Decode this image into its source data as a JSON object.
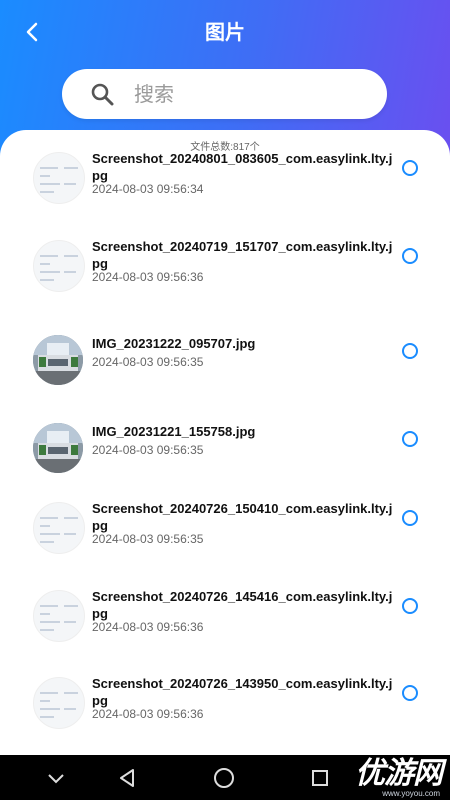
{
  "header": {
    "title": "图片",
    "back_icon": "chevron-left-icon",
    "gradient": [
      "#1a8cff",
      "#3f6df5",
      "#6a4ff0"
    ]
  },
  "search": {
    "placeholder": "搜索",
    "icon": "search-icon"
  },
  "summary": {
    "total_text": "文件总数:817个"
  },
  "files": [
    {
      "name": "Screenshot_20240801_083605_com.easylink.lty.jpg",
      "time": "2024-08-03 09:56:34",
      "thumb": "screenshot",
      "selected": false
    },
    {
      "name": "Screenshot_20240719_151707_com.easylink.lty.jpg",
      "time": "2024-08-03 09:56:36",
      "thumb": "screenshot",
      "selected": false
    },
    {
      "name": "IMG_20231222_095707.jpg",
      "time": "2024-08-03 09:56:35",
      "thumb": "photo",
      "selected": false
    },
    {
      "name": "IMG_20231221_155758.jpg",
      "time": "2024-08-03 09:56:35",
      "thumb": "photo",
      "selected": false
    },
    {
      "name": "Screenshot_20240726_150410_com.easylink.lty.jpg",
      "time": "2024-08-03 09:56:35",
      "thumb": "screenshot",
      "selected": false
    },
    {
      "name": "Screenshot_20240726_145416_com.easylink.lty.jpg",
      "time": "2024-08-03 09:56:36",
      "thumb": "screenshot",
      "selected": false
    },
    {
      "name": "Screenshot_20240726_143950_com.easylink.lty.jpg",
      "time": "2024-08-03 09:56:36",
      "thumb": "screenshot",
      "selected": false
    }
  ],
  "navbar": {
    "buttons": [
      "chevron-down-icon",
      "back-triangle-icon",
      "home-circle-icon",
      "recents-square-icon"
    ]
  },
  "watermark": {
    "text": "优游网",
    "url": "www.yoyou.com"
  },
  "colors": {
    "accent": "#1a8cff",
    "navbar": "#000000"
  }
}
